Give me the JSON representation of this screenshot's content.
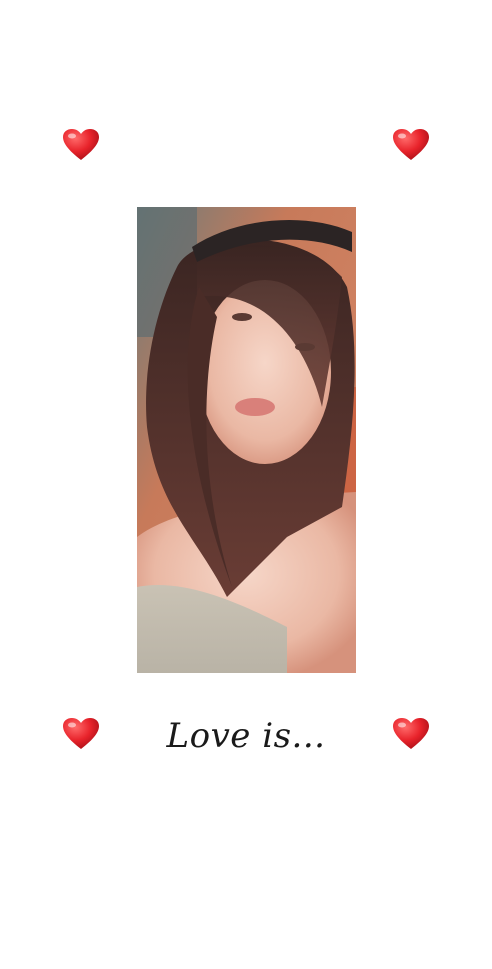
{
  "caption": {
    "text": "Love is..."
  },
  "decorations": {
    "heart_icon": "red-heart-icon",
    "heart_color": "#e8232b"
  },
  "photo": {
    "subject": "selfie-portrait"
  }
}
